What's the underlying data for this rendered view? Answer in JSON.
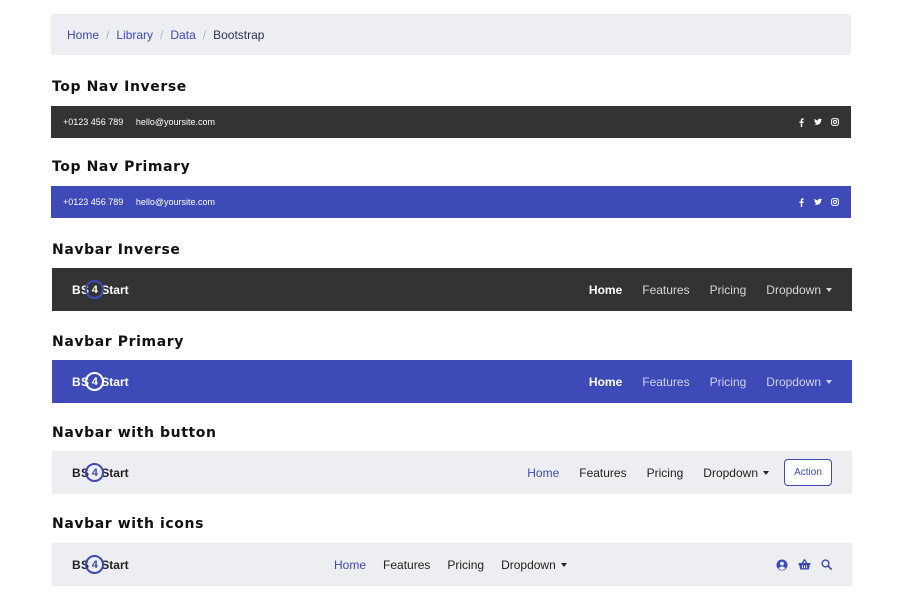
{
  "breadcrumb": [
    "Home",
    "Library",
    "Data",
    "Bootstrap"
  ],
  "sections": {
    "top_nav_inverse": "Top Nav Inverse",
    "top_nav_primary": "Top Nav Primary",
    "navbar_inverse": "Navbar Inverse",
    "navbar_primary": "Navbar Primary",
    "navbar_button": "Navbar with button",
    "navbar_icons": "Navbar with icons"
  },
  "topnav": {
    "phone": "+0123 456 789",
    "email": "hello@yoursite.com",
    "social_icons": [
      "facebook-icon",
      "twitter-icon",
      "instagram-icon"
    ]
  },
  "brand": {
    "left": "BS",
    "num": "4",
    "right": "Start"
  },
  "nav": {
    "home": "Home",
    "features": "Features",
    "pricing": "Pricing",
    "dropdown": "Dropdown"
  },
  "action_button": "Action",
  "right_icons": [
    "user-icon",
    "basket-icon",
    "search-icon"
  ],
  "colors": {
    "primary": "#3d4ab8",
    "dark": "#333333",
    "light_bg": "#eceef1"
  }
}
